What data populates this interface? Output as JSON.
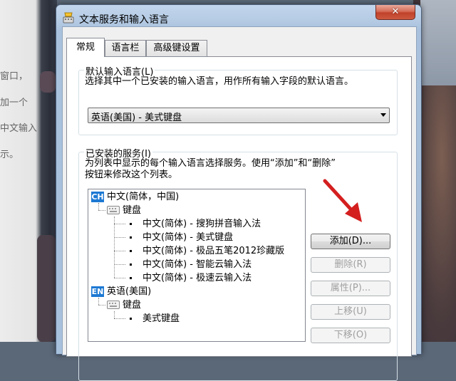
{
  "background": {
    "text_lines": [
      "窗口，",
      "加一个",
      "中文输入",
      "示。"
    ]
  },
  "window": {
    "title": "文本服务和输入语言",
    "close_label": "✕",
    "title_icon": "input-language-icon"
  },
  "tabs": [
    {
      "label": "常规",
      "active": true
    },
    {
      "label": "语言栏",
      "active": false
    },
    {
      "label": "高级键设置",
      "active": false
    }
  ],
  "default_language": {
    "legend": "默认输入语言(L)",
    "description": "选择其中一个已安装的输入语言，用作所有输入字段的默认语言。",
    "selected": "英语(美国) - 美式键盘"
  },
  "installed_services": {
    "legend": "已安装的服务(I)",
    "description_line1": "为列表中显示的每个输入语言选择服务。使用“添加”和“删除”",
    "description_line2": "按钮来修改这个列表。",
    "tree": {
      "lang1": {
        "badge": "CH",
        "label": "中文(简体，中国)"
      },
      "group1": "键盘",
      "items1": [
        "中文(简体) - 搜狗拼音输入法",
        "中文(简体) - 美式键盘",
        "中文(简体) - 极品五笔2012珍藏版",
        "中文(简体) - 智能云输入法",
        "中文(简体) - 极速云输入法"
      ],
      "lang2": {
        "badge": "EN",
        "label": "英语(美国)"
      },
      "group2": "键盘",
      "items2": [
        "美式键盘"
      ]
    }
  },
  "buttons": {
    "add": "添加(D)...",
    "remove": "删除(R)",
    "properties": "属性(P)...",
    "move_up": "上移(U)",
    "move_down": "下移(O)"
  },
  "colors": {
    "accent_blue": "#1d79d3",
    "annotation_red": "#d41f1f"
  }
}
